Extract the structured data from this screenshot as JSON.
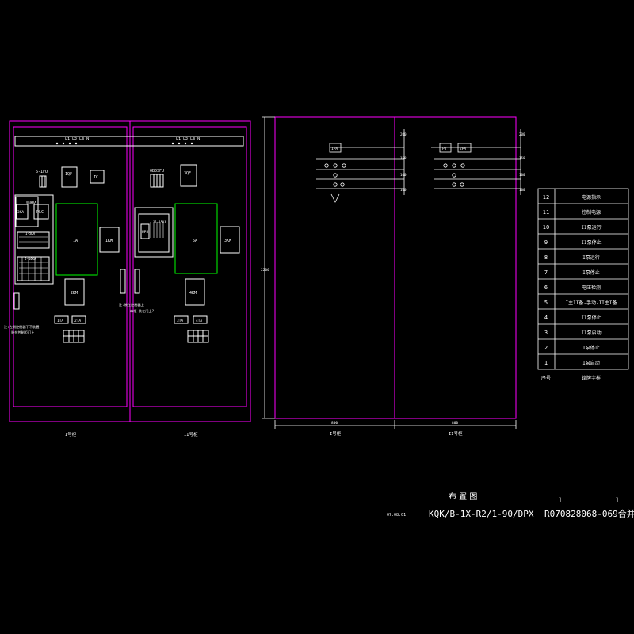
{
  "colors": {
    "background": "#000000",
    "frame": "#ff00ff",
    "line": "#ffffff",
    "device_green": "#00ff00"
  },
  "left_panel": {
    "bus_label_1": "L1 L2 L3 N",
    "bus_label_2": "L1 L2 L3 N",
    "cab1": {
      "fu": "6-1FU",
      "qf": "1QF",
      "tc": "TC",
      "ka": "3KA",
      "plc": "PLC",
      "rel1": "1-5KA",
      "rel2": "6-10KA",
      "contactor_main": "1A",
      "km1": "1KM",
      "km2": "2KM",
      "ta1": "1TA",
      "ta2": "2TA",
      "note": "注:左侧控制器下不装置\n 装在控制柜门上"
    },
    "cab2": {
      "fu": "0B0SFU",
      "qf": "3QF",
      "ups": "UPS",
      "ka": "8KA",
      "relay": "11-15KA",
      "contactor_main": "5A",
      "km3": "3KM",
      "km4": "4KM",
      "ta3": "3TA",
      "ta4": "4TA",
      "note": "注:装在控制器上 本柜 装在门上?"
    },
    "label_1": "I号柜",
    "label_2": "II号柜"
  },
  "front_view": {
    "height_dim": "2200",
    "width_dim_1": "800",
    "width_dim_2": "800",
    "label_1": "I号柜",
    "label_2": "II号柜",
    "dims_right_1": [
      "200",
      "150",
      "100",
      "100"
    ],
    "dims_right_2": [
      "200",
      "150",
      "100",
      "100"
    ],
    "meters_1": [
      "1PA"
    ],
    "meters_2": [
      "PV",
      "2PA"
    ]
  },
  "legend_table": {
    "rows": [
      {
        "no": "12",
        "desc": "电源指示"
      },
      {
        "no": "11",
        "desc": "控制电源"
      },
      {
        "no": "10",
        "desc": "II泵运行"
      },
      {
        "no": "9",
        "desc": "II泵停止"
      },
      {
        "no": "8",
        "desc": "I泵运行"
      },
      {
        "no": "7",
        "desc": "I泵停止"
      },
      {
        "no": "6",
        "desc": "电压检测"
      },
      {
        "no": "5",
        "desc": "I主II备-手动-II主I备"
      },
      {
        "no": "4",
        "desc": "II泵停止"
      },
      {
        "no": "3",
        "desc": "II泵启动"
      },
      {
        "no": "2",
        "desc": "I泵停止"
      },
      {
        "no": "1",
        "desc": "I泵启动"
      }
    ],
    "header": {
      "no": "序号",
      "desc": "铭牌字样"
    }
  },
  "title_block": {
    "title": "布  置  图",
    "date": "07.08.01",
    "drawing_no": "KQK/B-1X-R2/1-90/DPX",
    "serial": "R070828068-069合并柜",
    "sheet": "1",
    "total": "1"
  }
}
